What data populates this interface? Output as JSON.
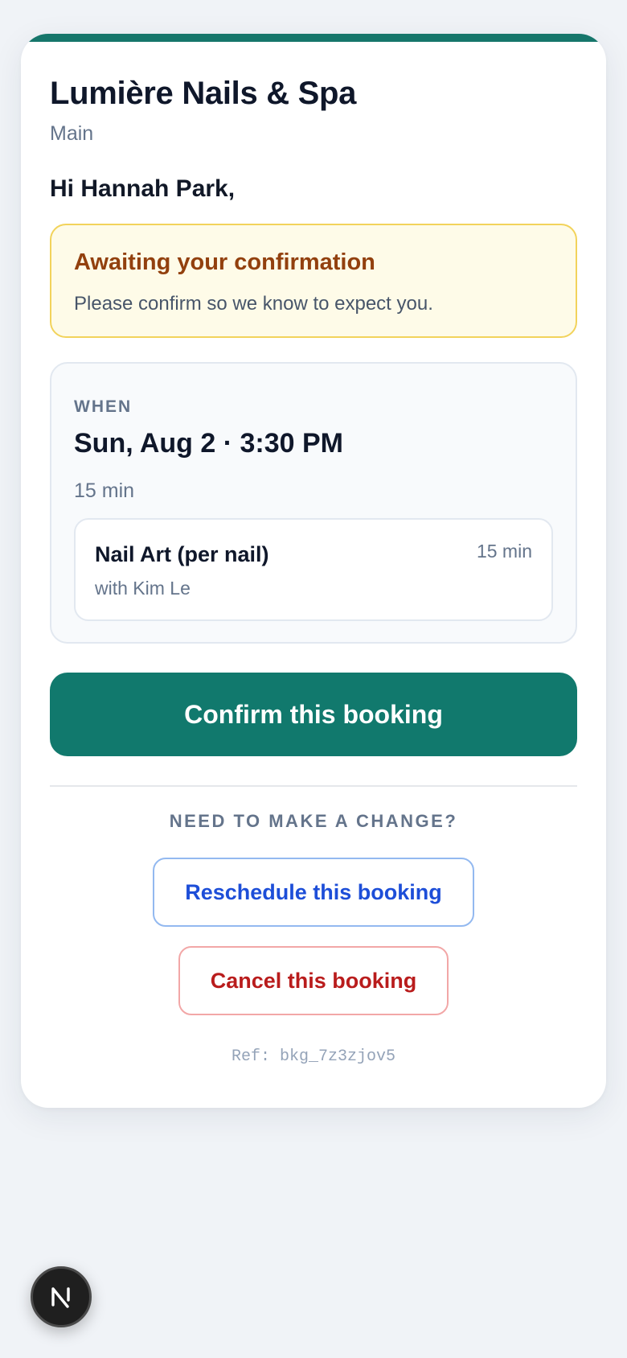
{
  "business": {
    "name": "Lumière Nails & Spa",
    "location": "Main"
  },
  "greeting": "Hi Hannah Park,",
  "status": {
    "title": "Awaiting your confirmation",
    "message": "Please confirm so we know to expect you."
  },
  "appointment": {
    "label": "WHEN",
    "datetime": "Sun, Aug 2 · 3:30 PM",
    "duration": "15 min",
    "services": [
      {
        "name": "Nail Art (per nail)",
        "staff": "with Kim Le",
        "duration": "15 min"
      }
    ]
  },
  "actions": {
    "confirm_label": "Confirm this booking",
    "change_heading": "NEED TO MAKE A CHANGE?",
    "reschedule_label": "Reschedule this booking",
    "cancel_label": "Cancel this booking"
  },
  "reference": "Ref: bkg_7z3zjov5",
  "colors": {
    "accent": "#11796d",
    "alert_border": "#f2d35b",
    "alert_background": "#fefbe8",
    "alert_title": "#92400e",
    "reschedule": "#1d4ed8",
    "cancel": "#b91c1c"
  },
  "dev_badge": {
    "icon": "nextjs-logo-icon"
  }
}
